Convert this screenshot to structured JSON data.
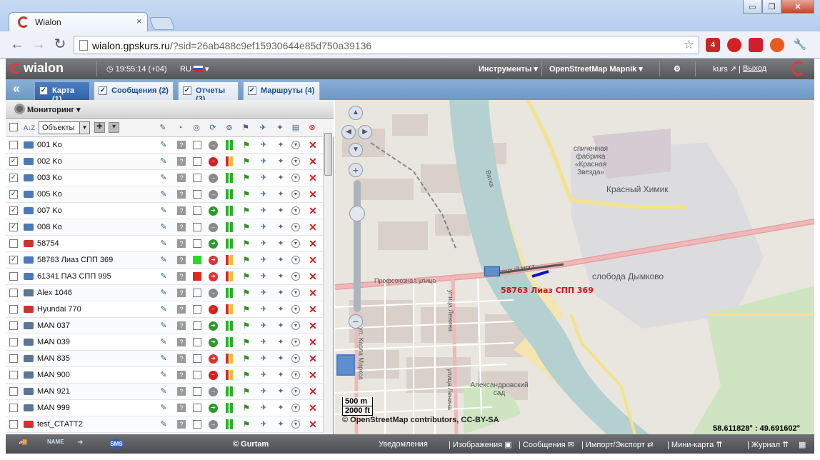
{
  "browser": {
    "tab_title": "Wialon",
    "tab_close": "×",
    "window_buttons": {
      "minimize": "▭",
      "restore": "❐",
      "close": "✕"
    },
    "back": "←",
    "forward": "→",
    "reload": "↻",
    "url_host": "wialon.gpskurs.ru",
    "url_rest": "/?sid=26ab488c9ef15930644e85d750a39136",
    "star": "☆",
    "extension_badge": "4",
    "wrench": "🔧"
  },
  "app": {
    "logo": "wialon",
    "clock": "19:55:14 (+04)",
    "language": "RU",
    "menu_tools": "Инструменты",
    "menu_map": "OpenStreetMap Mapnik",
    "user": "kurs",
    "logout": "Выход",
    "colors": {
      "accent": "#2f62a8",
      "danger": "#d41b1b",
      "online": "#26d92a"
    }
  },
  "tabs": [
    {
      "label": "Карта (1)",
      "active": true
    },
    {
      "label": "Сообщения (2)",
      "active": false
    },
    {
      "label": "Отчеты (3)",
      "active": false
    },
    {
      "label": "Маршруты (4)",
      "active": false
    }
  ],
  "panel": {
    "title": "Мониторинг",
    "filter_select": "Объекты",
    "sort_icon": "A↓Z"
  },
  "units": [
    {
      "name": "001 Ko",
      "checked": false,
      "icon": "bus-icon",
      "status_color": "",
      "motion": "stopped"
    },
    {
      "name": "002 Ko",
      "checked": true,
      "icon": "bus-icon",
      "status_color": "",
      "motion": "no-data"
    },
    {
      "name": "003 Ko",
      "checked": true,
      "icon": "bus-icon",
      "status_color": "",
      "motion": "stopped"
    },
    {
      "name": "005 Ko",
      "checked": true,
      "icon": "bus-icon",
      "status_color": "",
      "motion": "stopped"
    },
    {
      "name": "007 Ko",
      "checked": true,
      "icon": "bus-icon",
      "status_color": "",
      "motion": "moving"
    },
    {
      "name": "008 Ko",
      "checked": true,
      "icon": "bus-icon",
      "status_color": "",
      "motion": "stopped"
    },
    {
      "name": "58754",
      "checked": false,
      "icon": "car-icon",
      "status_color": "",
      "motion": "moving"
    },
    {
      "name": "58763 Лиаз СПП 369",
      "checked": true,
      "icon": "bus-icon",
      "status_color": "#26d92a",
      "motion": "alert"
    },
    {
      "name": "61341 ПАЗ СПП 995",
      "checked": false,
      "icon": "bus-icon",
      "status_color": "#e2261e",
      "motion": "alert"
    },
    {
      "name": "Alex 1046",
      "checked": false,
      "icon": "truck-icon",
      "status_color": "",
      "motion": "stopped"
    },
    {
      "name": "Hyundai 770",
      "checked": false,
      "icon": "car-icon",
      "status_color": "",
      "motion": "no-data"
    },
    {
      "name": "MAN 037",
      "checked": false,
      "icon": "truck-icon",
      "status_color": "",
      "motion": "moving"
    },
    {
      "name": "MAN 039",
      "checked": false,
      "icon": "truck-icon",
      "status_color": "",
      "motion": "moving"
    },
    {
      "name": "MAN 835",
      "checked": false,
      "icon": "truck-icon",
      "status_color": "",
      "motion": "alert"
    },
    {
      "name": "MAN 900",
      "checked": false,
      "icon": "truck-icon",
      "status_color": "",
      "motion": "no-data"
    },
    {
      "name": "MAN 921",
      "checked": false,
      "icon": "truck-icon",
      "status_color": "",
      "motion": "stopped"
    },
    {
      "name": "MAN 999",
      "checked": false,
      "icon": "truck-icon",
      "status_color": "",
      "motion": "moving"
    },
    {
      "name": "test_СТАТТ2",
      "checked": false,
      "icon": "car-icon",
      "status_color": "",
      "motion": "stopped"
    }
  ],
  "map": {
    "labels": {
      "factory": "спичечная фабрика «Красная Звезда»",
      "krasny_khimik": "Красный Химик",
      "dymkovo": "слобода Дымково",
      "profsoyuznaya": "Профсоюзная улица",
      "bridge": "Старый мост",
      "river": "Вятка",
      "lenin": "улица Ленина",
      "karla_marksa": "ул. Карла Маркса",
      "lenina2": "улица Ленина",
      "park": "Александровский сад"
    },
    "unit_label": "58763 Лиаз СПП 369",
    "scale_metric": "500 m",
    "scale_imperial": "2000 ft",
    "copyright": "© OpenStreetMap contributors, CC-BY-SA",
    "coordinates": "58.611828° : 49.691602°"
  },
  "bottom": {
    "icons": [
      "truck-icon",
      "name-icon",
      "arrow-truck-icon",
      "sms-icon"
    ],
    "sms": "SMS",
    "name": "NAME",
    "brand": "© Gurtam",
    "notifications": "Уведомления",
    "images": "Изображения",
    "messages": "Сообщения",
    "import_export": "Импорт/Экспорт",
    "minimap": "Мини-карта",
    "journal": "Журнал"
  }
}
